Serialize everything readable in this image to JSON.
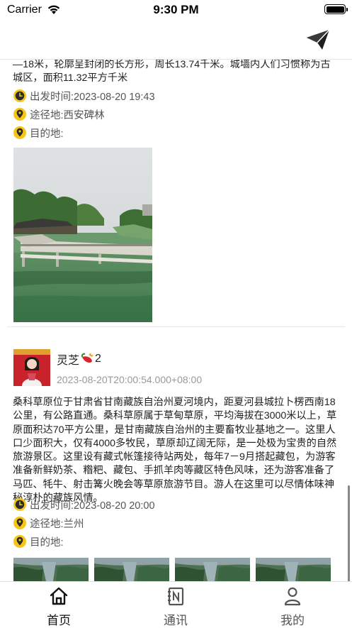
{
  "status_bar": {
    "carrier": "Carrier",
    "time": "9:30 PM"
  },
  "post1": {
    "text_tail": "—18米，轮廓呈封闭的长方形，周长13.74千米。城墙内人们习惯称为古城区，面积11.32平方千米",
    "departure": "出发时间:2023-08-20 19:43",
    "via": "途径地:西安碑林",
    "destination": "目的地:"
  },
  "post2": {
    "username": "灵芝",
    "username_suffix": "2",
    "timestamp": "2023-08-20T20:00:54.000+08:00",
    "text": "桑科草原位于甘肃省甘南藏族自治州夏河境内，距夏河县城拉卜楞西南18公里，有公路直通。桑科草原属于草甸草原，平均海拔在3000米以上，草原面积达70平方公里，是甘南藏族自治州的主要畜牧业基地之一。这里人口少面积大，仅有4000多牧民，草原却辽阔无际，是一处极为宝贵的自然旅游景区。这里设有藏式帐篷接待站两处，每年7－9月搭起藏包，为游客准备新鲜奶茶、糌粑、藏包、手抓羊肉等藏区特色风味，还为游客准备了马匹、牦牛、射击篝火晚会等草原旅游节目。游人在这里可以尽情体味神秘淳朴的藏族风情。",
    "departure": "出发时间:2023-08-20 20:00",
    "via": "途径地:兰州",
    "destination": "目的地:"
  },
  "tabs": [
    {
      "label": "首页",
      "icon": "home-icon",
      "active": true
    },
    {
      "label": "通讯",
      "icon": "contacts-icon",
      "active": false
    },
    {
      "label": "我的",
      "icon": "profile-icon",
      "active": false
    }
  ],
  "colors": {
    "accent_icon": "#f5c518",
    "icon_dark": "#2b2b2b"
  }
}
